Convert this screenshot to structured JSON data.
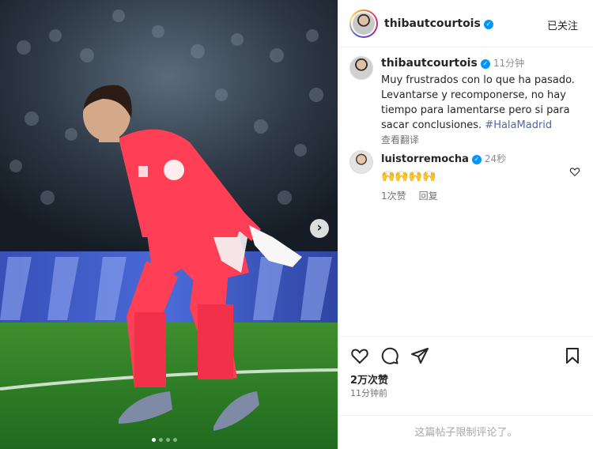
{
  "post": {
    "author": "thibautcourtois",
    "follow_status": "已关注",
    "verified_mark": "✓",
    "caption": {
      "author": "thibautcourtois",
      "time": "11分钟",
      "text": "Muy frustrados con lo que ha pasado. Levantarse y recomponerse, no hay tiempo para lamentarse pero si para sacar conclusiones.",
      "hashtag": "#HalaMadrid",
      "translate_label": "查看翻译"
    },
    "comments": [
      {
        "author": "luistorremocha",
        "time": "24秒",
        "text": "🙌🙌🙌🙌",
        "likes": "1次赞",
        "reply_label": "回复"
      }
    ],
    "likes": "2万次赞",
    "posted_ago": "11分钟前",
    "comments_disabled": "这篇帖子限制评论了。"
  },
  "carousel": {
    "total": 4,
    "active_index": 0,
    "next_glyph": "›"
  },
  "icons": {
    "like": "heart-icon",
    "comment": "comment-icon",
    "share": "share-icon",
    "save": "bookmark-icon",
    "comment_like": "heart-icon"
  },
  "colors": {
    "accent_blue": "#0095f6",
    "hashtag": "#4f66a8",
    "jersey": "#ff3f55",
    "pitch": "#2f8a2a"
  }
}
